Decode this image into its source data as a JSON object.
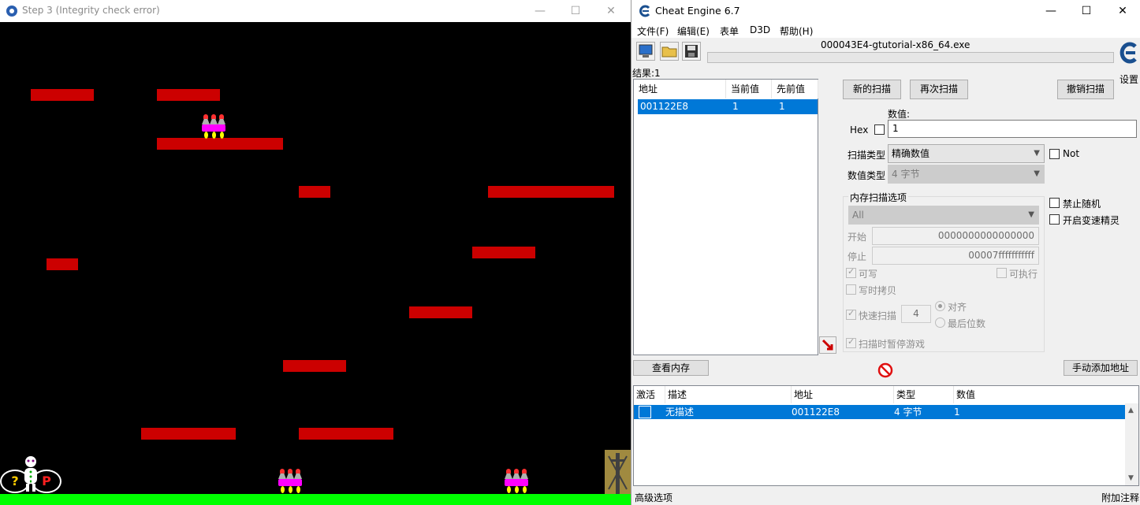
{
  "game": {
    "title": "Step 3 (Integrity check error)",
    "caption": {
      "minimize": "—",
      "maximize": "☐",
      "close": "✕"
    },
    "hud": {
      "help": "?",
      "pause": "P"
    },
    "colors": {
      "background": "#000000",
      "platform": "#cc0000",
      "ground": "#00ff00",
      "enemy": "#ff00ff"
    }
  },
  "ce": {
    "title": "Cheat Engine 6.7",
    "caption": {
      "minimize": "—",
      "maximize": "☐",
      "close": "✕"
    },
    "menu": {
      "file": "文件(F)",
      "edit": "编辑(E)",
      "table": "表单",
      "d3d": "D3D",
      "help": "帮助(H)"
    },
    "process": "000043E4-gtutorial-x86_64.exe",
    "settings": "设置",
    "found": "结果:1",
    "results": {
      "headers": {
        "address": "地址",
        "current": "当前值",
        "previous": "先前值"
      },
      "rows": [
        {
          "address": "001122E8",
          "current": "1",
          "previous": "1"
        }
      ]
    },
    "buttons": {
      "new_scan": "新的扫描",
      "next_scan": "再次扫描",
      "undo_scan": "撤销扫描",
      "view_memory": "查看内存",
      "add_manual": "手动添加地址"
    },
    "value": {
      "label": "数值:",
      "hex": "Hex",
      "current": "1"
    },
    "scan_type": {
      "label": "扫描类型",
      "selected": "精确数值",
      "not": "Not"
    },
    "value_type": {
      "label": "数值类型",
      "selected": "4 字节"
    },
    "mem_options": {
      "title": "内存扫描选项",
      "region": "All",
      "start_label": "开始",
      "start": "0000000000000000",
      "stop_label": "停止",
      "stop": "00007fffffffffff",
      "writable": "可写",
      "executable": "可执行",
      "copy_on_write": "写时拷贝",
      "fast_scan": "快速扫描",
      "fast_value": "4",
      "align": "对齐",
      "last_digits": "最后位数",
      "pause_game": "扫描时暂停游戏"
    },
    "side_options": {
      "no_random": "禁止随机",
      "speedhack": "开启变速精灵"
    },
    "table": {
      "headers": {
        "active": "激活",
        "description": "描述",
        "address": "地址",
        "type": "类型",
        "value": "数值"
      },
      "rows": [
        {
          "description": "无描述",
          "address": "001122E8",
          "type": "4 字节",
          "value": "1"
        }
      ]
    },
    "status": {
      "advanced": "高级选项",
      "comments": "附加注释"
    },
    "colors": {
      "selection": "#0078d7"
    }
  }
}
